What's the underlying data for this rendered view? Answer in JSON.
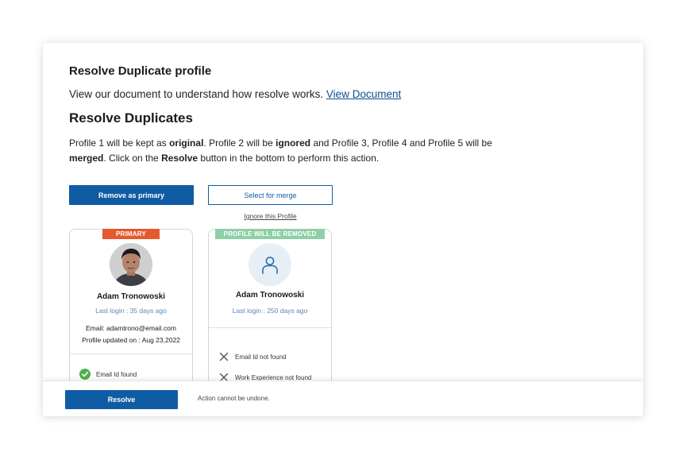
{
  "heading": "Resolve Duplicate profile",
  "intro": {
    "text": "View our document to understand how resolve works. ",
    "link": "View Document"
  },
  "subheading": "Resolve Duplicates",
  "description": {
    "p1": "Profile 1 will be kept as ",
    "b1": "original",
    "p2": ". Profile 2 will be ",
    "b2": "ignored",
    "p3": " and Profile 3, Profile 4 and Profile 5 will be ",
    "b3": "merged",
    "p4": ". Click on the ",
    "b4": "Resolve",
    "p5": " button in the bottom to perform this action."
  },
  "actions": {
    "remove_primary": "Remove as primary",
    "select_merge": "Select for merge",
    "ignore_profile": "Ignore this Profile"
  },
  "cards": [
    {
      "badge": "PRIMARY",
      "badge_color": "#e35a2e",
      "name": "Adam Tronowoski",
      "last_login": "Last login : 35 days ago",
      "email": "Email: adamtrono@email.com",
      "updated": "Profile updated on : Aug 23,2022",
      "features": [
        {
          "icon": "check-circle-icon",
          "label": "Email Id found"
        }
      ]
    },
    {
      "badge": "PROFILE WILL BE REMOVED",
      "badge_color": "#8fcfa7",
      "name": "Adam Tronowoski",
      "last_login": "Last login : 250 days ago",
      "features": [
        {
          "icon": "close-icon",
          "label": "Email Id not found"
        },
        {
          "icon": "close-icon",
          "label": "Work Experience not found"
        }
      ]
    }
  ],
  "footer": {
    "resolve": "Resolve",
    "note": "Action cannot be undone."
  },
  "colors": {
    "primary_blue": "#105ca4",
    "link_blue": "#0b4f8f",
    "login_blue": "#5887b7",
    "success_green": "#4cb04f"
  }
}
